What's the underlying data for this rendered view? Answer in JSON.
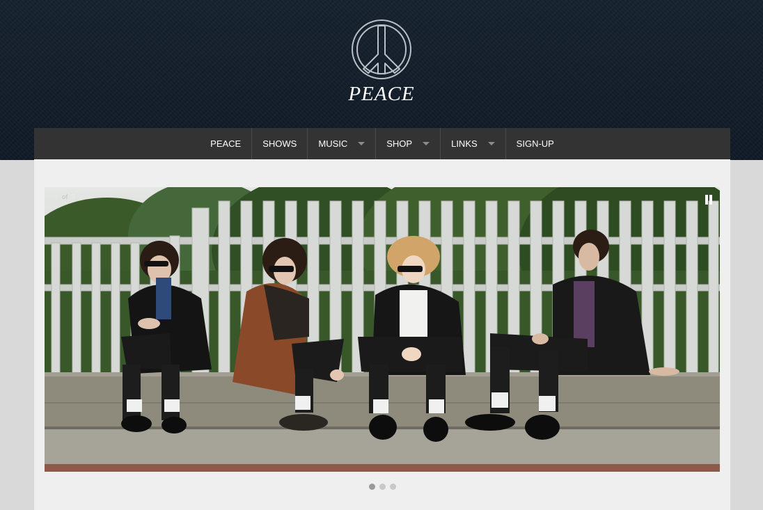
{
  "logo": {
    "text": "PEACE",
    "icon": "peace-symbol-icon"
  },
  "nav": {
    "items": [
      {
        "label": "PEACE",
        "dropdown": false
      },
      {
        "label": "SHOWS",
        "dropdown": false
      },
      {
        "label": "MUSIC",
        "dropdown": true
      },
      {
        "label": "SHOP",
        "dropdown": true
      },
      {
        "label": "LINKS",
        "dropdown": true
      },
      {
        "label": "SIGN-UP",
        "dropdown": false
      }
    ]
  },
  "slider": {
    "current": "1",
    "of_label": "of",
    "total": "3",
    "pause_icon": "pause-icon",
    "active_dot": 1,
    "dot_count": 3
  },
  "colors": {
    "header_bg": "#13202c",
    "nav_bg": "#333333",
    "content_bg": "#efefef",
    "page_bg": "#d9d9d9"
  }
}
